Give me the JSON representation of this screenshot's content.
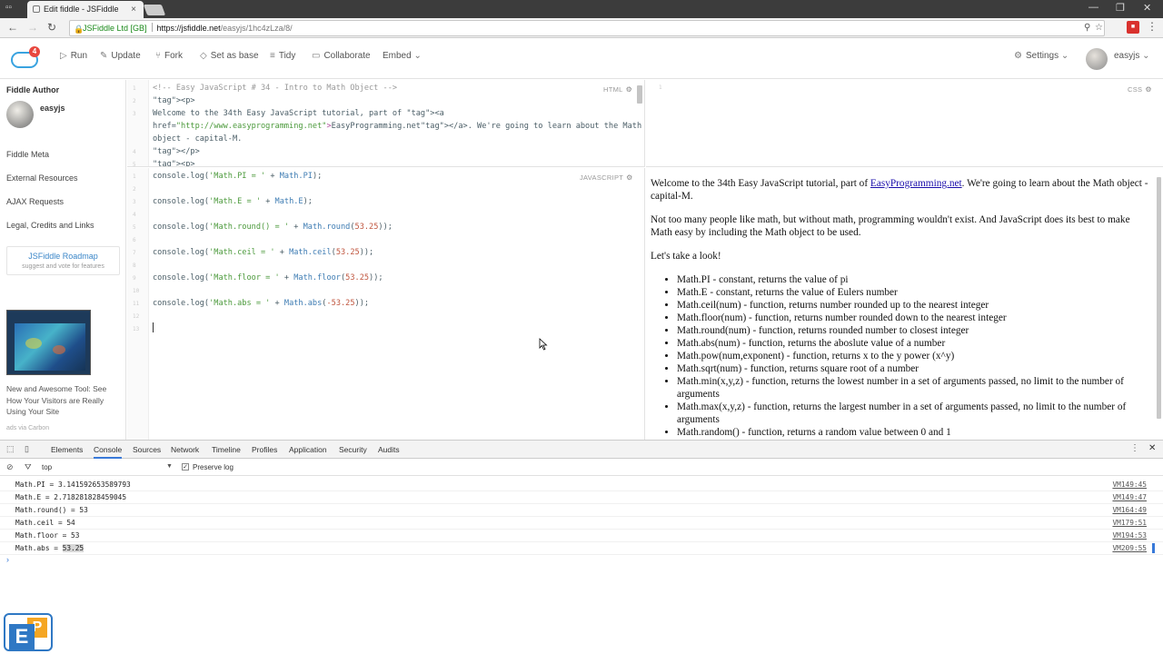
{
  "browser": {
    "tab_title": "Edit fiddle - JSFiddle",
    "tab_close": "×",
    "secure_label": "JSFiddle Ltd [GB]",
    "url_host": "https://jsfiddle.net",
    "url_path": "/easyjs/1hc4zLza/8/",
    "minimize": "—",
    "maximize": "❐",
    "close": "✕"
  },
  "toolbar": {
    "logo_badge": "4",
    "run": "Run",
    "update": "Update",
    "fork": "Fork",
    "set_as_base": "Set as base",
    "tidy": "Tidy",
    "collaborate": "Collaborate",
    "embed": "Embed",
    "settings": "Settings",
    "username": "easyjs"
  },
  "sidebar": {
    "author_heading": "Fiddle Author",
    "author_name": "easyjs",
    "items": [
      "Fiddle Meta",
      "External Resources",
      "AJAX Requests",
      "Legal, Credits and Links"
    ],
    "roadmap_title": "JSFiddle Roadmap",
    "roadmap_sub": "suggest and vote for features",
    "ad_text": "New and Awesome Tool: See How Your Visitors are Really Using Your Site",
    "ad_via": "ads via Carbon"
  },
  "panes": {
    "html_label": "HTML",
    "css_label": "CSS",
    "js_label": "JAVASCRIPT"
  },
  "html_lines": [
    {
      "n": "1",
      "text": "<!-- Easy JavaScript # 34 - Intro to Math Object -->"
    },
    {
      "n": "2",
      "text": "<p>"
    },
    {
      "n": "3",
      "text": "Welcome to the 34th Easy JavaScript tutorial, part of <a"
    },
    {
      "n": "",
      "text": "href=\"http://www.easyprogramming.net\">EasyProgramming.net</a>. We're going to learn about the Math"
    },
    {
      "n": "",
      "text": "object - capital-M."
    },
    {
      "n": "4",
      "text": "</p>"
    },
    {
      "n": "5",
      "text": "<p>"
    }
  ],
  "css_gutter": "1",
  "js_lines": [
    {
      "n": "1",
      "text": "console.log('Math.PI = ' + Math.PI);"
    },
    {
      "n": "2",
      "text": ""
    },
    {
      "n": "3",
      "text": "console.log('Math.E = ' + Math.E);"
    },
    {
      "n": "4",
      "text": ""
    },
    {
      "n": "5",
      "text": "console.log('Math.round() = ' + Math.round(53.25));"
    },
    {
      "n": "6",
      "text": ""
    },
    {
      "n": "7",
      "text": "console.log('Math.ceil = ' + Math.ceil(53.25));"
    },
    {
      "n": "8",
      "text": ""
    },
    {
      "n": "9",
      "text": "console.log('Math.floor = ' + Math.floor(53.25));"
    },
    {
      "n": "10",
      "text": ""
    },
    {
      "n": "11",
      "text": "console.log('Math.abs = ' + Math.abs(-53.25));"
    },
    {
      "n": "12",
      "text": ""
    },
    {
      "n": "13",
      "text": ""
    }
  ],
  "result": {
    "p1_before": "Welcome to the 34th Easy JavaScript tutorial, part of ",
    "p1_link": "EasyProgramming.net",
    "p1_after": ". We're going to learn about the Math object - capital-M.",
    "p2": "Not too many people like math, but without math, programming wouldn't exist. And JavaScript does its best to make Math easy by including the Math object to be used.",
    "p3": "Let's take a look!",
    "items": [
      "Math.PI - constant, returns the value of pi",
      "Math.E - constant, returns the value of Eulers number",
      "Math.ceil(num) - function, returns number rounded up to the nearest integer",
      "Math.floor(num) - function, returns number rounded down to the nearest integer",
      "Math.round(num) - function, returns rounded number to closest integer",
      "Math.abs(num) - function, returns the aboslute value of a number",
      "Math.pow(num,exponent) - function, returns x to the y power (x^y)",
      "Math.sqrt(num) - function, returns square root of a number",
      "Math.min(x,y,z) - function, returns the lowest number in a set of arguments passed, no limit to the number of arguments",
      "Math.max(x,y,z) - function, returns the largest number in a set of arguments passed, no limit to the number of arguments",
      "Math.random() - function, returns a random value between 0 and 1"
    ]
  },
  "devtools": {
    "tabs": [
      "Elements",
      "Console",
      "Sources",
      "Network",
      "Timeline",
      "Profiles",
      "Application",
      "Security",
      "Audits"
    ],
    "active_tab": "Console",
    "context": "top",
    "preserve_log": "Preserve log",
    "logs": [
      {
        "msg": "Math.PI = 3.141592653589793",
        "src": "VM149:45"
      },
      {
        "msg": "Math.E = 2.718281828459045",
        "src": "VM149:47"
      },
      {
        "msg": "Math.round() = 53",
        "src": "VM164:49"
      },
      {
        "msg": "Math.ceil = 54",
        "src": "VM179:51"
      },
      {
        "msg": "Math.floor = 53",
        "src": "VM194:53"
      },
      {
        "msg": "Math.abs = ",
        "hl": "53.25",
        "src": "VM209:55"
      }
    ],
    "prompt": "›"
  },
  "watermark": {
    "e": "E",
    "p": "P"
  }
}
